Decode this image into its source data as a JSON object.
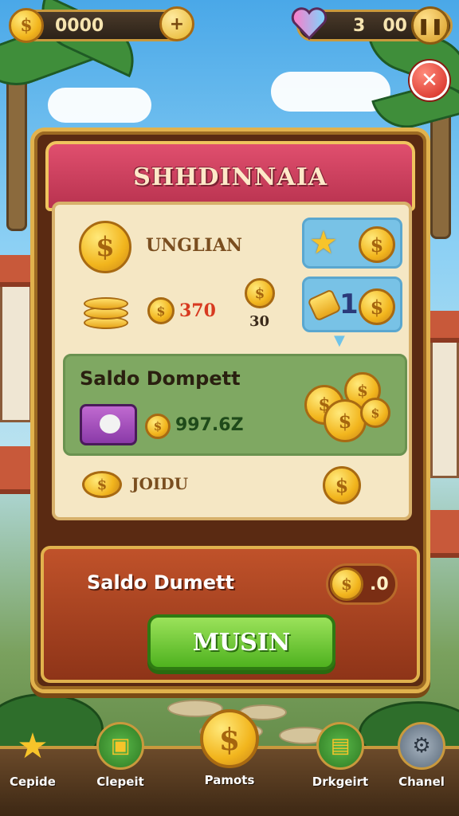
{
  "hud": {
    "coins_value": "0000",
    "lives_value": "3",
    "lives_value2": "00",
    "pause_icon": "pause-icon",
    "close_icon": "close-icon"
  },
  "panel": {
    "title": "SHHDINNAIA",
    "row1_label": "UNGLIAN",
    "row2_value": "370",
    "row2_side_value": "30",
    "side_card2_value": "1",
    "saldo_title": "Saldo Dompett",
    "saldo_value": "997.6Z",
    "row4_label": "JOIDU",
    "saldo2_label": "Saldo Dumett",
    "saldo2_value": ".0",
    "main_button": "MUSIN"
  },
  "nav": {
    "items": [
      {
        "label": "Cepide",
        "icon": "star-icon"
      },
      {
        "label": "Clepeit",
        "icon": "shop-icon"
      },
      {
        "label": "Pamots",
        "icon": "coin-icon"
      },
      {
        "label": "Drkgeirt",
        "icon": "card-icon"
      },
      {
        "label": "Chanel",
        "icon": "gear-icon"
      }
    ]
  },
  "colors": {
    "header": "#c83a58",
    "button_green": "#5cc12a",
    "gold": "#f2b51d",
    "panel_brown": "#8e3418"
  }
}
